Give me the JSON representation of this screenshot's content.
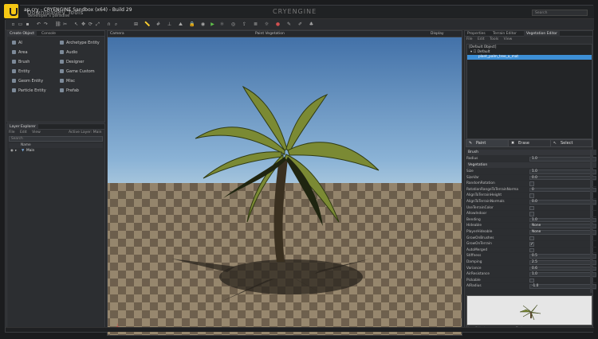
{
  "window": {
    "title": "ap.cry - CRYENGINE Sandbox (x64) - Build 29",
    "watermark": "Downloadev Tools",
    "subtitle": "developer's paradise",
    "logo_text": "CRYENGINE",
    "search_placeholder": "Search"
  },
  "left_panel": {
    "tabs": [
      "Create Object",
      "Console"
    ],
    "col1": [
      "AI",
      "Area",
      "Brush",
      "Entity",
      "Geom Entity",
      "Particle Entity"
    ],
    "col2": [
      "Archetype Entity",
      "Audio",
      "Designer",
      "Game Custom",
      "Misc",
      "Prefab"
    ]
  },
  "layer_explorer": {
    "title": "Layer Explorer",
    "menu": [
      "File",
      "Edit",
      "View"
    ],
    "active_layer_label": "Active Layer: Main",
    "search_placeholder": "Search",
    "column_header": "Name",
    "rows": [
      "Main"
    ]
  },
  "viewport": {
    "tabs": [
      "Perspective",
      "Flow Graph"
    ],
    "camera_label": "Camera",
    "mode_label": "Paint Vegetation",
    "display_label": "Display"
  },
  "right_panel": {
    "tabs": [
      "Properties",
      "Terrain Editor",
      "Vegetation Editor"
    ],
    "menu": [
      "File",
      "Edit",
      "Tools",
      "View"
    ],
    "tree_root": "[Default Object]",
    "tree_child": "Default",
    "tree_selected": "plant_palm_tree_a_mat",
    "tools": [
      "Paint",
      "Erase",
      "Select"
    ],
    "brush_section": "Brush",
    "brush_rows": [
      {
        "label": "Radius",
        "value": "1.0"
      }
    ],
    "veg_section": "Vegetation",
    "veg_rows": [
      {
        "label": "Size",
        "value": "1.0"
      },
      {
        "label": "SizeVar",
        "value": "0.0"
      },
      {
        "label": "RandomRotation",
        "value": ""
      },
      {
        "label": "RotationRangeToTerrainNorma",
        "value": "0"
      },
      {
        "label": "AlignToTerrainHeight",
        "value": ""
      },
      {
        "label": "AlignToTerrainNormals",
        "value": "0.0"
      },
      {
        "label": "UseTerrainColor",
        "value": ""
      },
      {
        "label": "AllowIndoor",
        "value": ""
      },
      {
        "label": "Bending",
        "value": "1.0"
      },
      {
        "label": "Hideable",
        "value": "None"
      },
      {
        "label": "PlayerHideable",
        "value": "None"
      },
      {
        "label": "GrowOnBrushes",
        "value": ""
      },
      {
        "label": "GrowOnTerrain",
        "value": "check"
      },
      {
        "label": "AutoMerged",
        "value": ""
      },
      {
        "label": "Stiffness",
        "value": "0.5"
      },
      {
        "label": "Damping",
        "value": "2.5"
      },
      {
        "label": "Variance",
        "value": "0.6"
      },
      {
        "label": "AirResistance",
        "value": "1.0"
      },
      {
        "label": "Pickable",
        "value": ""
      },
      {
        "label": "AIRadius",
        "value": "-1.0"
      }
    ],
    "status_left": "Num Objects",
    "status_right": "Texture usage"
  },
  "statusbar": {
    "text": ""
  }
}
